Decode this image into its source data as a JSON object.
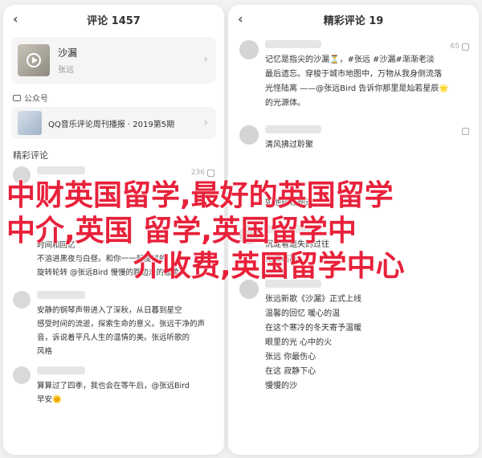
{
  "left_phone": {
    "nav_title": "评论 1457",
    "song": {
      "title": "沙漏",
      "artist": "张远"
    },
    "official_label": "公众号",
    "article_title": "QQ音乐评论周刊播报 · 2019第5期",
    "comments_heading": "精彩评论",
    "comments": [
      {
        "likes": "236",
        "lines": [],
        "time": ""
      },
      {
        "likes": "",
        "lines": [
          "一条评论",
          "时间和回忆",
          "我们选择独自一人",
          "不溶进黑夜与白昼。和你一一起度过的",
          "旋转轮转 @张远Bird 慢慢的路边走的温柔。"
        ],
        "time": ""
      },
      {
        "likes": "",
        "lines": [
          "安静的钢琴声带进入了深秋，从日暮到星空",
          "感受时间的流逝，探索生命的意义。张远干净的声",
          "音，诉说着平凡人生的温情的美。张远听歌的",
          "风格"
        ],
        "time": ""
      },
      {
        "likes": "",
        "lines": [
          "算算过了四季，我也会在等午后，@张远Bird",
          "早安🌞"
        ],
        "time": ""
      }
    ]
  },
  "right_phone": {
    "nav_title": "精彩评论 19",
    "comments": [
      {
        "likes": "65",
        "lines": [
          "记忆是指尖的沙漏⏳，#张远 #沙漏#渐渐老淡",
          "最后遗忘。穿梭于城市地图中，万物从我身侧流落",
          "光怪陆离 ——@张远Bird 告诉你那里是灿若星辰🌟",
          "的光源体。"
        ]
      },
      {
        "likes": "",
        "lines": [
          "清风拂过聆聚",
          "",
          "",
          "如他轻轻刷过"
        ]
      },
      {
        "likes": "",
        "lines": [
          "沉淀着遗失的过往",
          "无法逃离"
        ]
      },
      {
        "likes": "",
        "lines": [
          "张远新歌《沙漏》正式上线",
          "温馨的回忆 暖心的温",
          "在这个寒冷的冬天寄予温暖",
          "眼里的光 心中的火",
          "张远 你最伤心",
          "在这 寂静下心",
          "慢慢的沙"
        ]
      }
    ]
  },
  "overlay_text": {
    "line1": "中财英国留学,最好的英国留学",
    "line2": "中介,英国 留学,英国留学中",
    "line3": "介收费,英国留学中心"
  }
}
